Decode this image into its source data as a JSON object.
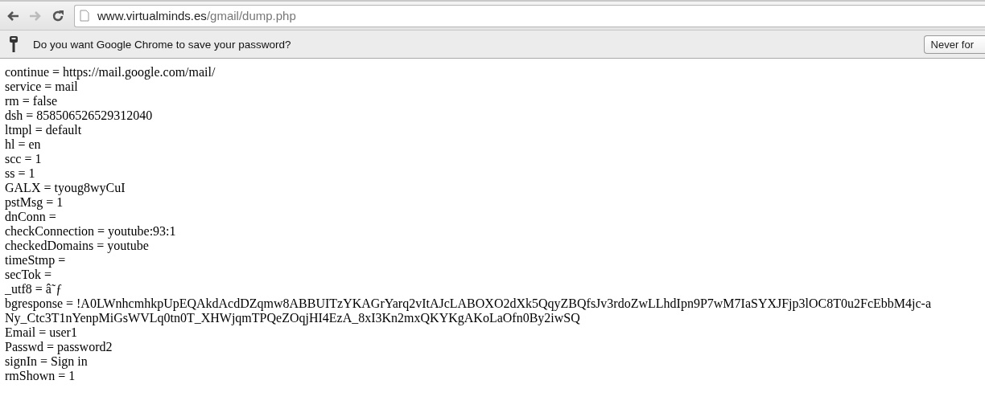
{
  "toolbar": {
    "url_host": "www.virtualminds.es",
    "url_path": "/gmail/dump.php",
    "back_disabled": false,
    "forward_disabled": true
  },
  "infobar": {
    "message": "Do you want Google Chrome to save your password?",
    "button": "Never for"
  },
  "lines": [
    "continue = https://mail.google.com/mail/",
    "service = mail",
    "rm = false",
    "dsh = 858506526529312040",
    "ltmpl = default",
    "hl = en",
    "scc = 1",
    "ss = 1",
    "GALX = tyoug8wyCuI",
    "pstMsg = 1",
    "dnConn =",
    "checkConnection = youtube:93:1",
    "checkedDomains = youtube",
    "timeStmp =",
    "secTok =",
    "_utf8 = â˜ƒ",
    "bgresponse = !A0LWnhcmhkpUpEQAkdAcdDZqmw8ABBUITzYKAGrYarq2vItAJcLABOXO2dXk5QqyZBQfsJv3rdoZwLLhdIpn9P7wM7IaSYXJFjp3lOC8T0u2FcEbbM4jc-aNy_Ctc3T1nYenpMiGsWVLq0tn0T_XHWjqmTPQeZOqjHI4EzA_8xI3Kn2mxQKYKgAKoLaOfn0By2iwSQ",
    "Email = user1",
    "Passwd = password2",
    "signIn = Sign in",
    "rmShown = 1"
  ]
}
